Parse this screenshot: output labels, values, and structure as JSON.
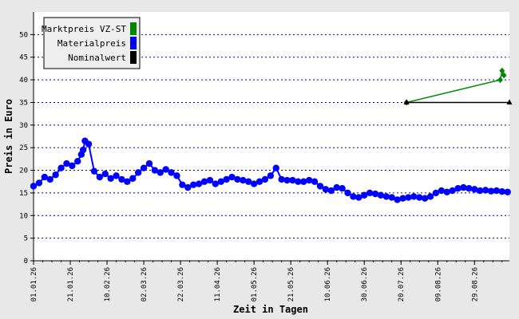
{
  "chart_data": {
    "type": "line",
    "xlabel": "Zeit in Tagen",
    "ylabel": "Preis in Euro",
    "ylim": [
      0,
      55
    ],
    "yticks": [
      0,
      5,
      10,
      15,
      20,
      25,
      30,
      35,
      40,
      45,
      50
    ],
    "x_range": [
      "2026-01-01",
      "2026-09-17"
    ],
    "x_ticks": [
      "2026-01-01",
      "2026-01-21",
      "2026-02-10",
      "2026-03-02",
      "2026-03-22",
      "2026-04-11",
      "2026-05-01",
      "2026-05-21",
      "2026-06-10",
      "2026-06-30",
      "2026-07-20",
      "2026-08-09",
      "2026-08-29"
    ],
    "x_tick_labels": [
      "01.01.26",
      "21.01.26",
      "10.02.26",
      "02.03.26",
      "22.03.26",
      "11.04.26",
      "01.05.26",
      "21.05.26",
      "10.06.26",
      "30.06.26",
      "20.07.26",
      "09.08.26",
      "29.08.26"
    ],
    "grid": "horizontal-dotted",
    "legend_position": "top-left",
    "series": [
      {
        "name": "Marktpreis VZ-ST",
        "color": "#008800",
        "marker": "diamond",
        "x": [
          "2026-07-23",
          "2026-09-12",
          "2026-09-13",
          "2026-09-14"
        ],
        "y": [
          35,
          40,
          42,
          41
        ]
      },
      {
        "name": "Materialpreis",
        "color": "#0000ff",
        "marker": "circle",
        "x": [
          "2026-01-01",
          "2026-01-04",
          "2026-01-07",
          "2026-01-10",
          "2026-01-13",
          "2026-01-16",
          "2026-01-19",
          "2026-01-22",
          "2026-01-25",
          "2026-01-27",
          "2026-01-28",
          "2026-01-29",
          "2026-01-31",
          "2026-02-03",
          "2026-02-06",
          "2026-02-09",
          "2026-02-12",
          "2026-02-15",
          "2026-02-18",
          "2026-02-21",
          "2026-02-24",
          "2026-02-27",
          "2026-03-02",
          "2026-03-05",
          "2026-03-08",
          "2026-03-11",
          "2026-03-14",
          "2026-03-17",
          "2026-03-20",
          "2026-03-23",
          "2026-03-26",
          "2026-03-29",
          "2026-04-01",
          "2026-04-04",
          "2026-04-07",
          "2026-04-10",
          "2026-04-13",
          "2026-04-16",
          "2026-04-19",
          "2026-04-22",
          "2026-04-25",
          "2026-04-28",
          "2026-05-01",
          "2026-05-04",
          "2026-05-07",
          "2026-05-10",
          "2026-05-13",
          "2026-05-16",
          "2026-05-19",
          "2026-05-22",
          "2026-05-25",
          "2026-05-28",
          "2026-05-31",
          "2026-06-03",
          "2026-06-06",
          "2026-06-09",
          "2026-06-12",
          "2026-06-15",
          "2026-06-18",
          "2026-06-21",
          "2026-06-24",
          "2026-06-27",
          "2026-06-30",
          "2026-07-03",
          "2026-07-06",
          "2026-07-09",
          "2026-07-12",
          "2026-07-15",
          "2026-07-18",
          "2026-07-21",
          "2026-07-24",
          "2026-07-27",
          "2026-07-30",
          "2026-08-02",
          "2026-08-05",
          "2026-08-08",
          "2026-08-11",
          "2026-08-14",
          "2026-08-17",
          "2026-08-20",
          "2026-08-23",
          "2026-08-26",
          "2026-08-29",
          "2026-09-01",
          "2026-09-04",
          "2026-09-07",
          "2026-09-10",
          "2026-09-13",
          "2026-09-16"
        ],
        "y": [
          16.5,
          17.2,
          18.5,
          18.0,
          19.0,
          20.5,
          21.5,
          21.0,
          22.0,
          23.5,
          24.5,
          26.5,
          25.8,
          19.8,
          18.5,
          19.2,
          18.2,
          18.8,
          18.0,
          17.5,
          18.2,
          19.5,
          20.5,
          21.5,
          20.0,
          19.5,
          20.2,
          19.5,
          18.8,
          16.8,
          16.2,
          16.8,
          17.0,
          17.5,
          17.8,
          17.0,
          17.5,
          18.0,
          18.5,
          18.0,
          17.8,
          17.5,
          17.0,
          17.5,
          18.0,
          18.8,
          20.5,
          18.0,
          17.8,
          17.8,
          17.5,
          17.5,
          17.8,
          17.5,
          16.5,
          15.8,
          15.5,
          16.2,
          16.0,
          15.0,
          14.2,
          14.0,
          14.5,
          15.0,
          14.8,
          14.5,
          14.2,
          14.0,
          13.5,
          13.8,
          14.0,
          14.2,
          14.0,
          13.8,
          14.2,
          15.0,
          15.5,
          15.2,
          15.5,
          16.0,
          16.2,
          16.0,
          15.8,
          15.5,
          15.6,
          15.4,
          15.5,
          15.3,
          15.2
        ]
      },
      {
        "name": "Nominalwert",
        "color": "#000000",
        "marker": "triangle",
        "x": [
          "2026-07-23",
          "2026-09-17"
        ],
        "y": [
          35,
          35
        ]
      }
    ]
  }
}
